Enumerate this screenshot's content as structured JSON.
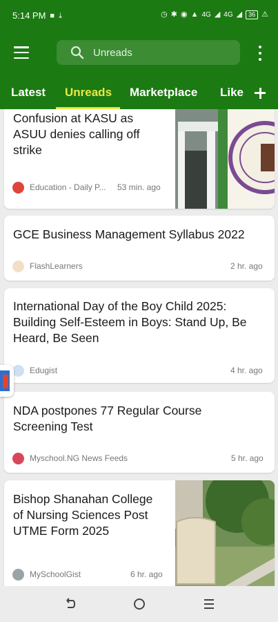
{
  "status_bar": {
    "time": "5:14 PM",
    "network_4g_1": "4G",
    "network_4g_2": "4G",
    "battery": "36"
  },
  "app_bar": {
    "search_placeholder": "Unreads"
  },
  "tabs": [
    {
      "label": "Latest",
      "active": false
    },
    {
      "label": "Unreads",
      "active": true
    },
    {
      "label": "Marketplace",
      "active": false
    },
    {
      "label": "Like",
      "active": false
    }
  ],
  "feed": {
    "articles": [
      {
        "title_lines": [
          "Confusion at KASU as",
          "ASUU denies calling off",
          "strike"
        ],
        "source": "Education - Daily P...",
        "time": "53 min. ago"
      },
      {
        "title_lines": [
          "GCE Business Management Syllabus 2022"
        ],
        "source": "FlashLearners",
        "time": "2 hr. ago"
      },
      {
        "title_lines": [
          "International Day of the Boy Child 2025:",
          "Building Self-Esteem in Boys: Stand Up, Be",
          "Heard, Be Seen"
        ],
        "source": "Edugist",
        "time": "4 hr. ago"
      },
      {
        "title_lines": [
          "NDA postpones 77 Regular Course",
          "Screening Test"
        ],
        "source": "Myschool.NG News Feeds",
        "time": "5 hr. ago"
      },
      {
        "title_lines": [
          "Bishop Shanahan College",
          "of Nursing Sciences Post",
          "UTME Form 2025"
        ],
        "source": "MySchoolGist",
        "time": "6 hr. ago"
      }
    ]
  },
  "colors": {
    "app_green": "#1b7a12",
    "active_tab": "#e9ea4a",
    "background": "#ececec"
  }
}
